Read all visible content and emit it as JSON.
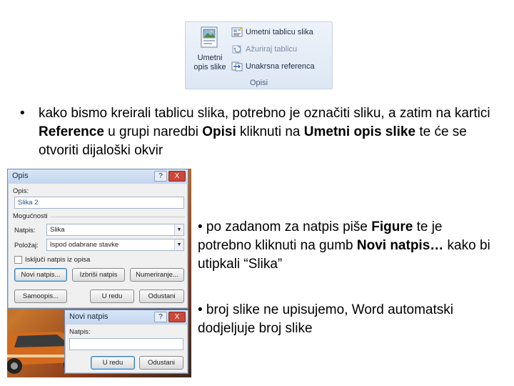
{
  "ribbon": {
    "big_button_label": "Umetni opis slike",
    "items": [
      {
        "label": "Umetni tablicu slika",
        "icon": "table-of-figures-icon",
        "enabled": true
      },
      {
        "label": "Ažuriraj tablicu",
        "icon": "update-table-icon",
        "enabled": false
      },
      {
        "label": "Unakrsna referenca",
        "icon": "cross-reference-icon",
        "enabled": true
      }
    ],
    "group_label": "Opisi"
  },
  "bullets": {
    "b1_dot": "•",
    "b1_part1": "kako bismo kreirali tablicu slika, potrebno je označiti sliku, a zatim na kartici ",
    "b1_bold1": "Reference",
    "b1_part2": " u grupi naredbi ",
    "b1_bold2": "Opisi",
    "b1_part3": " kliknuti na ",
    "b1_bold3": "Umetni opis slike",
    "b1_part4": " te će se otvoriti dijaloški okvir",
    "b2_part1": "• po zadanom za natpis piše ",
    "b2_bold1": "Figure",
    "b2_part2": " te je potrebno kliknuti na gumb ",
    "b2_bold2": "Novi natpis…",
    "b2_part3": " kako bi utipkali “Slika”",
    "b3_text": "• broj slike ne upisujemo, Word automatski dodjeljuje broj slike"
  },
  "opis_dialog": {
    "title": "Opis",
    "help_button": "?",
    "close_button": "X",
    "opis_label": "Opis:",
    "opis_value": "Slika 2",
    "mogucnosti_label": "Mogućnosti",
    "natpis_label": "Natpis:",
    "natpis_value": "Slika",
    "polozaj_label": "Položaj:",
    "polozaj_value": "Ispod odabrane stavke",
    "exclude_label": "Isključi natpis iz opisa",
    "novi_natpis_button": "Novi natpis...",
    "izbrisi_natpis_button": "Izbriši natpis",
    "numeriranje_button": "Numeriranje...",
    "samoopis_button": "Samoopis...",
    "ok_button": "U redu",
    "cancel_button": "Odustani"
  },
  "novi_natpis_dialog": {
    "title": "Novi natpis",
    "help_button": "?",
    "close_button": "X",
    "natpis_label": "Natpis:",
    "natpis_value": "",
    "ok_button": "U redu",
    "cancel_button": "Odustani"
  },
  "colors": {
    "ribbon_bg": "#dde7f4",
    "dialog_bg": "#f0f0f0",
    "close_red": "#c9483a"
  }
}
